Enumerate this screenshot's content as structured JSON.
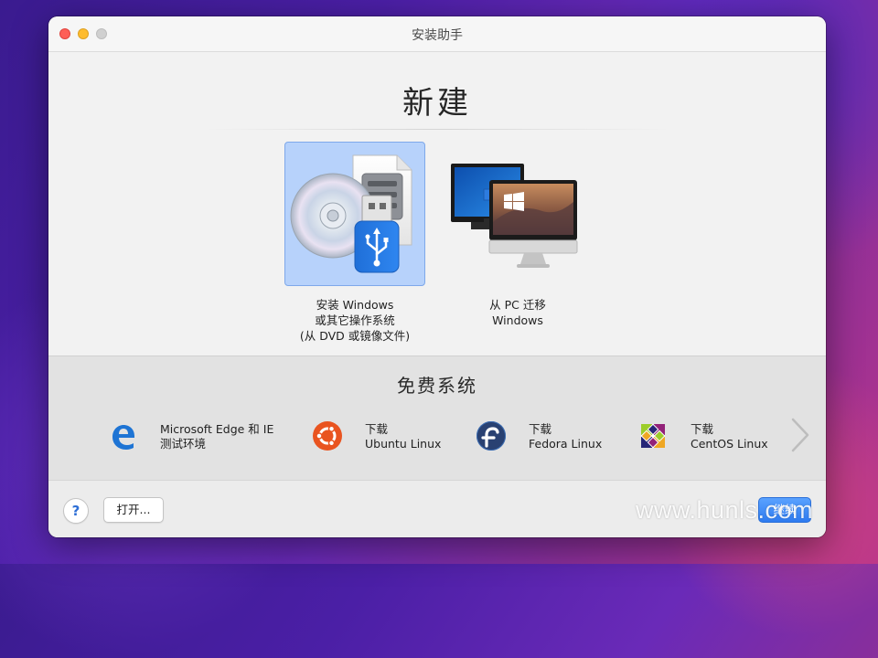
{
  "window": {
    "title": "安装助手"
  },
  "main": {
    "heading": "新建",
    "options": [
      {
        "line1": "安装 Windows",
        "line2": "或其它操作系统",
        "line3": "(从 DVD 或镜像文件)",
        "selected": true
      },
      {
        "line1": "从 PC 迁移",
        "line2": "Windows",
        "selected": false
      }
    ]
  },
  "free_systems": {
    "title": "免费系统",
    "items": [
      {
        "line1": "Microsoft Edge 和 IE",
        "line2": "测试环境",
        "icon": "edge-icon"
      },
      {
        "line1": "下载",
        "line2": "Ubuntu Linux",
        "icon": "ubuntu-icon"
      },
      {
        "line1": "下载",
        "line2": "Fedora Linux",
        "icon": "fedora-icon"
      },
      {
        "line1": "下载",
        "line2": "CentOS Linux",
        "icon": "centos-icon"
      }
    ]
  },
  "footer": {
    "help_label": "?",
    "open_label": "打开...",
    "continue_label": "继续"
  },
  "watermark": "www.hunls.com",
  "colors": {
    "selection": "#b7d2fb",
    "accent": "#2e7bf0"
  }
}
